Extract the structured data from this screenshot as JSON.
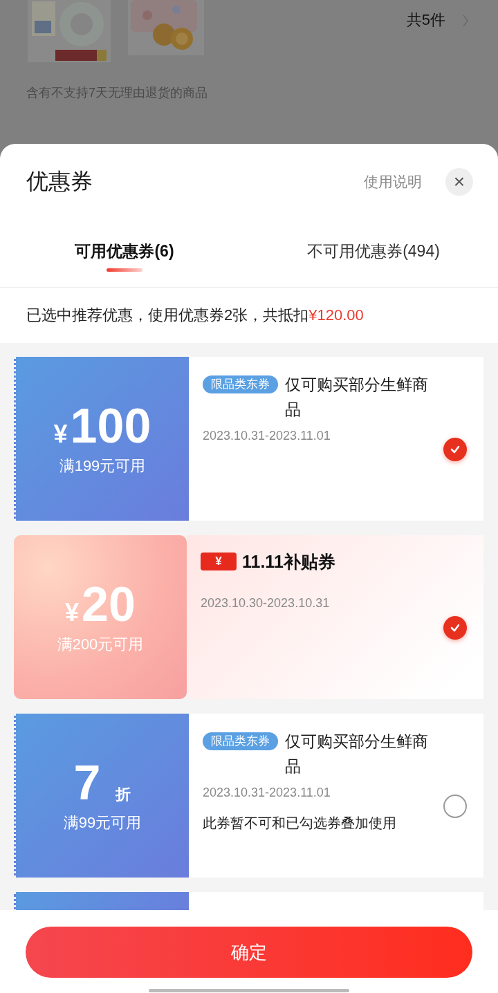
{
  "background": {
    "count": "共5件",
    "notice": "含有不支持7天无理由退货的商品"
  },
  "sheet": {
    "title": "优惠券",
    "help_link": "使用说明",
    "close": "×"
  },
  "tabs": [
    {
      "label": "可用优惠券(6)",
      "selected": true
    },
    {
      "label": "不可用优惠券(494)",
      "selected": false
    }
  ],
  "summary": {
    "text": "已选中推荐优惠，使用优惠券2张，共抵扣",
    "amount": "¥120.00"
  },
  "coupons": [
    {
      "kind": "category",
      "prefix": "¥",
      "value": "100",
      "condition": "满199元可用",
      "tag": "限品类东券",
      "title": "仅可购买部分生鲜商品",
      "dates": "2023.10.31-2023.11.01",
      "selected": true
    },
    {
      "kind": "subsidy",
      "prefix": "¥",
      "value": "20",
      "condition": "满200元可用",
      "badge_icon": "¥",
      "title": "11.11补贴券",
      "dates": "2023.10.30-2023.10.31",
      "selected": true
    },
    {
      "kind": "category",
      "value": "7",
      "suffix": "折",
      "condition": "满99元可用",
      "tag": "限品类东券",
      "title": "仅可购买部分生鲜商品",
      "dates": "2023.10.31-2023.11.01",
      "note": "此券暂不可和已勾选券叠加使用",
      "selected": false
    }
  ],
  "confirm_button": "确定"
}
